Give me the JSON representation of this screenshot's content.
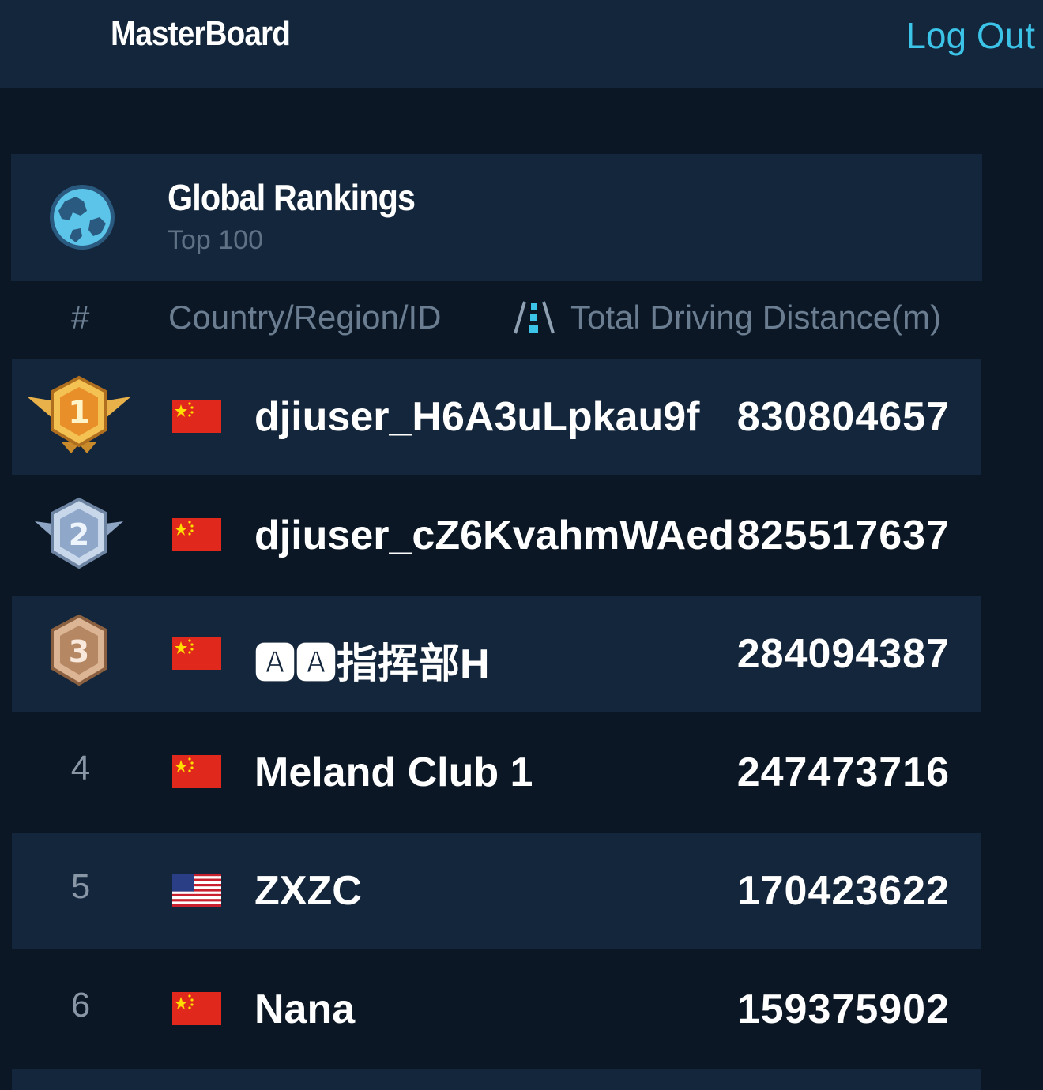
{
  "header": {
    "app_title": "MasterBoard",
    "logout_label": "Log Out"
  },
  "ranking_card": {
    "title": "Global Rankings",
    "subtitle": "Top 100"
  },
  "columns": {
    "rank": "#",
    "identity": "Country/Region/ID",
    "distance": "Total Driving Distance(m)"
  },
  "rows": [
    {
      "rank": "1",
      "country": "china",
      "name": "djiuser_H6A3uLpkau9f",
      "distance": "830804657"
    },
    {
      "rank": "2",
      "country": "china",
      "name": "djiuser_cZ6KvahmWAed",
      "distance": "825517637"
    },
    {
      "rank": "3",
      "country": "china",
      "name": "🅰🅰指挥部H",
      "distance": "284094387"
    },
    {
      "rank": "4",
      "country": "china",
      "name": "Meland Club 1",
      "distance": "247473716"
    },
    {
      "rank": "5",
      "country": "usa",
      "name": "ZXZC",
      "distance": "170423622"
    },
    {
      "rank": "6",
      "country": "china",
      "name": "Nana",
      "distance": "159375902"
    }
  ],
  "icons": {
    "globe": "globe-icon",
    "road": "road-icon",
    "medals": [
      "gold-medal-icon",
      "silver-medal-icon",
      "bronze-medal-icon"
    ]
  },
  "colors": {
    "accent": "#3cc3e8",
    "background": "#0b1725",
    "panel": "#13263b",
    "muted_text": "#6b7d90"
  }
}
